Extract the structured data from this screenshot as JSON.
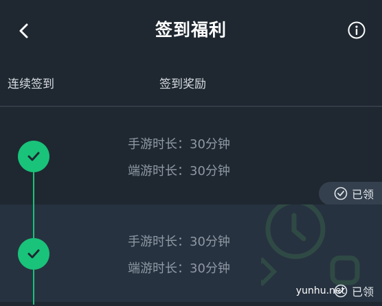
{
  "header": {
    "title": "签到福利"
  },
  "columns": {
    "streak": "连续签到",
    "reward": "签到奖励"
  },
  "rows": [
    {
      "mobile": "手游时长：30分钟",
      "pc": "端游时长：30分钟",
      "status": "已领"
    },
    {
      "mobile": "手游时长：30分钟",
      "pc": "端游时长：30分钟",
      "status": "已领"
    }
  ],
  "watermark": "yunhu.net",
  "colors": {
    "accent": "#19c37a",
    "background": "#1f2831",
    "row_alt": "#273240"
  },
  "icons": {
    "back": "back-arrow-icon",
    "info": "info-icon",
    "check": "check-icon",
    "claimed": "check-circle-icon"
  }
}
